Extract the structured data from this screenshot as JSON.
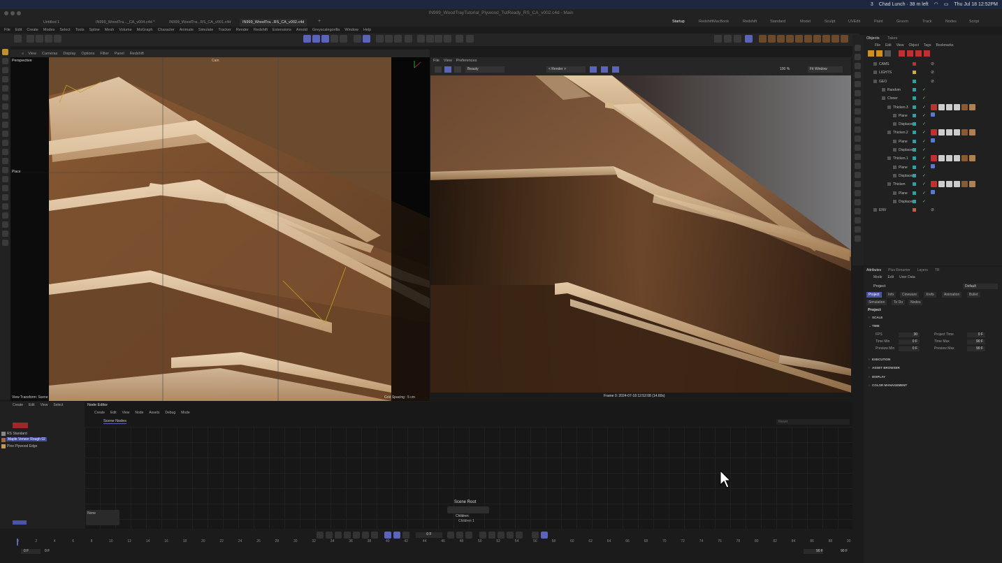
{
  "mac": {
    "time": "Thu Jul 18  12:52PM",
    "status": "Chad Lunch · 38 m left",
    "count": "3"
  },
  "window_title": "IN999_WoodTrayTutorial_Plywood_TutReady_RS_CA_v002.c4d - Main",
  "doc_tabs": [
    "Untitled 1",
    "IN999_WoodTra..._CA_v004.c4d *",
    "IN999_WoodTra...RS_CA_v001.c4d",
    "IN999_WoodTra...RS_CA_v002.c4d"
  ],
  "layout_tabs": [
    "Startup",
    "RedshiftMacBook",
    "Redshift",
    "Standard",
    "Model",
    "Sculpt",
    "UVEdit",
    "Paint",
    "Groom",
    "Track",
    "Nodes",
    "Script"
  ],
  "menu": [
    "File",
    "Edit",
    "Create",
    "Modes",
    "Select",
    "Tools",
    "Spline",
    "Mesh",
    "Volume",
    "MoGraph",
    "Character",
    "Animate",
    "Simulate",
    "Tracker",
    "Render",
    "Redshift",
    "Extensions",
    "Arnold",
    "Greyscalegorilla",
    "Window",
    "Help"
  ],
  "viewport": {
    "menu": [
      "View",
      "Cameras",
      "Display",
      "Options",
      "Filter",
      "Panel",
      "Redshift"
    ],
    "label": "Perspective",
    "camera": "Cam",
    "tool": "Place",
    "view_transform": "View Transform: Scene",
    "grid_spacing": "Grid Spacing : 5 cm"
  },
  "render_view": {
    "menu": [
      "File",
      "View",
      "Preferences"
    ],
    "aov": "Beauty",
    "render_select": "< Render >",
    "zoom": "100 %",
    "fit": "Fit Window",
    "frame_info": "Frame  0:  2024-07-18  12:52:08  (14.60s)"
  },
  "objects": {
    "tabs": [
      "Objects",
      "Takes"
    ],
    "menu": [
      "File",
      "Edit",
      "View",
      "Object",
      "Tags",
      "Bookmarks"
    ],
    "rows": [
      {
        "name": "CAMS",
        "color": "#c03030"
      },
      {
        "name": "LIGHTS",
        "color": "#d0b030"
      },
      {
        "name": "GEO",
        "color": "#30a0a0"
      },
      {
        "name": "Random",
        "color": "#30a0a0"
      },
      {
        "name": "Cloner",
        "color": "#30a0a0"
      },
      {
        "name": "Thicken.3",
        "color": "#30a0a0"
      },
      {
        "name": "Plane",
        "color": "#30a0a0"
      },
      {
        "name": "Displacer",
        "color": "#30a0a0"
      },
      {
        "name": "Thicken.2",
        "color": "#30a0a0"
      },
      {
        "name": "Plane",
        "color": "#30a0a0"
      },
      {
        "name": "Displacer",
        "color": "#30a0a0"
      },
      {
        "name": "Thicken.1",
        "color": "#30a0a0"
      },
      {
        "name": "Plane",
        "color": "#30a0a0"
      },
      {
        "name": "Displacer",
        "color": "#30a0a0"
      },
      {
        "name": "Thicken",
        "color": "#30a0a0"
      },
      {
        "name": "Plane",
        "color": "#30a0a0"
      },
      {
        "name": "Displacer",
        "color": "#30a0a0"
      },
      {
        "name": "ENV",
        "color": "#c06040"
      }
    ]
  },
  "attributes": {
    "tabs": [
      "Attributes",
      "Plus Renamer",
      "Layers",
      "TR"
    ],
    "menu": [
      "Mode",
      "Edit",
      "User Data"
    ],
    "object": "Project",
    "preset": "Default",
    "subtabs": [
      "Project",
      "Info",
      "Cineware",
      "Xrefs",
      "Animation",
      "Bullet",
      "Simulation",
      "To Do",
      "Nodes"
    ],
    "heading": "Project",
    "sections": [
      "SCALE",
      "TIME",
      "EXECUTION",
      "ASSET BROWSER",
      "DISPLAY",
      "COLOR MANAGEMENT"
    ],
    "fields": {
      "fps_label": "FPS",
      "fps": "30",
      "project_time_label": "Project Time",
      "project_time": "0 F",
      "time_min_label": "Time Min",
      "time_min": "0 F",
      "time_max_label": "Time Max",
      "time_max": "90 F",
      "preview_min_label": "Preview Min",
      "preview_min": "0 F",
      "preview_max_label": "Preview Max",
      "preview_max": "90 F"
    }
  },
  "material_manager": {
    "menu": [
      "Create",
      "Edit",
      "View",
      "Select"
    ],
    "items": [
      "RS Standard",
      "Maple Veneer Rough 02",
      "Pine Plywood Edge"
    ]
  },
  "node_editor": {
    "tab": "Node Editor",
    "menu": [
      "Create",
      "Edit",
      "View",
      "Node",
      "Assets",
      "Debug",
      "Mode"
    ],
    "subtab": "Scene Nodes",
    "search": "Reset",
    "none_label": "None",
    "node_title": "Scene Root",
    "node_port": "Children",
    "node_port2": "Children 1"
  },
  "timeline": {
    "ticks": [
      "0",
      "2",
      "4",
      "6",
      "8",
      "10",
      "12",
      "14",
      "16",
      "18",
      "20",
      "22",
      "24",
      "26",
      "28",
      "30",
      "32",
      "34",
      "36",
      "38",
      "40",
      "42",
      "44",
      "46",
      "48",
      "50",
      "52",
      "54",
      "56",
      "58",
      "60",
      "62",
      "64",
      "66",
      "68",
      "70",
      "72",
      "74",
      "76",
      "78",
      "80",
      "82",
      "84",
      "86",
      "88",
      "90"
    ],
    "current": "0 F",
    "start": "0 F",
    "start2": "0 F",
    "end": "90 F",
    "end2": "90 F"
  }
}
